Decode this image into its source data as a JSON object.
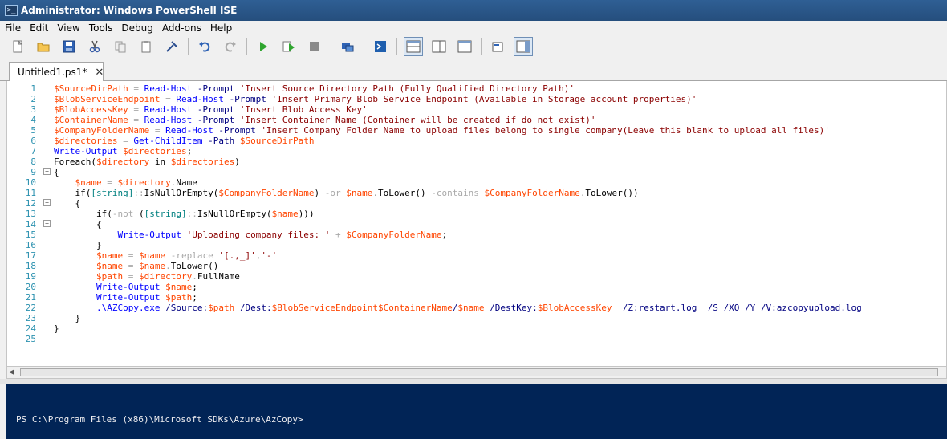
{
  "window": {
    "title": "Administrator: Windows PowerShell ISE",
    "app_icon_glyph": ">_"
  },
  "menu": [
    "File",
    "Edit",
    "View",
    "Tools",
    "Debug",
    "Add-ons",
    "Help"
  ],
  "toolbar": {
    "buttons": [
      {
        "name": "new-file-icon"
      },
      {
        "name": "open-folder-icon"
      },
      {
        "name": "save-icon"
      },
      {
        "name": "cut-icon"
      },
      {
        "name": "copy-icon"
      },
      {
        "name": "paste-icon"
      },
      {
        "name": "clear-console-icon"
      },
      {
        "name": "undo-icon"
      },
      {
        "name": "redo-icon"
      },
      {
        "name": "run-script-icon"
      },
      {
        "name": "run-selection-icon"
      },
      {
        "name": "stop-icon"
      },
      {
        "name": "remote-powershell-icon"
      },
      {
        "name": "powershell-console-icon"
      },
      {
        "name": "layout-top-icon"
      },
      {
        "name": "layout-right-icon"
      },
      {
        "name": "layout-max-icon"
      },
      {
        "name": "show-commands-icon"
      },
      {
        "name": "show-addon-icon"
      }
    ]
  },
  "tab": {
    "label": "Untitled1.ps1*",
    "close": "✕"
  },
  "colors": {
    "variable": "#ff4500",
    "cmdlet": "#0000ff",
    "string": "#8b0000",
    "operator": "#a9a9a9",
    "type": "#008080",
    "param": "#000080",
    "linenumber": "#2b91af",
    "console_bg": "#012456"
  },
  "code_lines": [
    [
      [
        "v",
        "$SourceDirPath"
      ],
      [
        "o",
        " = "
      ],
      [
        "c",
        "Read-Host"
      ],
      [
        "t",
        " "
      ],
      [
        "p",
        "-Prompt"
      ],
      [
        "t",
        " "
      ],
      [
        "s",
        "'Insert Source Directory Path (Fully Qualified Directory Path)'"
      ]
    ],
    [
      [
        "v",
        "$BlobServiceEndpoint"
      ],
      [
        "o",
        " = "
      ],
      [
        "c",
        "Read-Host"
      ],
      [
        "t",
        " "
      ],
      [
        "p",
        "-Prompt"
      ],
      [
        "t",
        " "
      ],
      [
        "s",
        "'Insert Primary Blob Service Endpoint (Available in Storage account properties)'"
      ]
    ],
    [
      [
        "v",
        "$BlobAccessKey"
      ],
      [
        "o",
        " = "
      ],
      [
        "c",
        "Read-Host"
      ],
      [
        "t",
        " "
      ],
      [
        "p",
        "-Prompt"
      ],
      [
        "t",
        " "
      ],
      [
        "s",
        "'Insert Blob Access Key'"
      ]
    ],
    [
      [
        "v",
        "$ContainerName"
      ],
      [
        "o",
        " = "
      ],
      [
        "c",
        "Read-Host"
      ],
      [
        "t",
        " "
      ],
      [
        "p",
        "-Prompt"
      ],
      [
        "t",
        " "
      ],
      [
        "s",
        "'Insert Container Name (Container will be created if do not exist)'"
      ]
    ],
    [
      [
        "v",
        "$CompanyFolderName"
      ],
      [
        "o",
        " = "
      ],
      [
        "c",
        "Read-Host"
      ],
      [
        "t",
        " "
      ],
      [
        "p",
        "-Prompt"
      ],
      [
        "t",
        " "
      ],
      [
        "s",
        "'Insert Company Folder Name to upload files belong to single company(Leave this blank to upload all files)'"
      ]
    ],
    [
      [
        "v",
        "$directories"
      ],
      [
        "o",
        " = "
      ],
      [
        "c",
        "Get-ChildItem"
      ],
      [
        "t",
        " "
      ],
      [
        "p",
        "-Path"
      ],
      [
        "t",
        " "
      ],
      [
        "v",
        "$SourceDirPath"
      ]
    ],
    [
      [
        "c",
        "Write-Output"
      ],
      [
        "t",
        " "
      ],
      [
        "v",
        "$directories"
      ],
      [
        "t",
        ";"
      ]
    ],
    [
      [
        "t",
        "Foreach("
      ],
      [
        "v",
        "$directory"
      ],
      [
        "t",
        " in "
      ],
      [
        "v",
        "$directories"
      ],
      [
        "t",
        ")"
      ]
    ],
    [
      [
        "t",
        "{"
      ]
    ],
    [
      [
        "t",
        "    "
      ],
      [
        "v",
        "$name"
      ],
      [
        "o",
        " = "
      ],
      [
        "v",
        "$directory"
      ],
      [
        "o",
        "."
      ],
      [
        "t",
        "Name"
      ]
    ],
    [
      [
        "t",
        "    if("
      ],
      [
        "y",
        "[string]"
      ],
      [
        "o",
        "::"
      ],
      [
        "t",
        "IsNullOrEmpty("
      ],
      [
        "v",
        "$CompanyFolderName"
      ],
      [
        "t",
        ") "
      ],
      [
        "o",
        "-or"
      ],
      [
        "t",
        " "
      ],
      [
        "v",
        "$name"
      ],
      [
        "o",
        "."
      ],
      [
        "t",
        "ToLower() "
      ],
      [
        "o",
        "-contains"
      ],
      [
        "t",
        " "
      ],
      [
        "v",
        "$CompanyFolderName"
      ],
      [
        "o",
        "."
      ],
      [
        "t",
        "ToLower())"
      ]
    ],
    [
      [
        "t",
        "    {"
      ]
    ],
    [
      [
        "t",
        "        if("
      ],
      [
        "o",
        "-not"
      ],
      [
        "t",
        " ("
      ],
      [
        "y",
        "[string]"
      ],
      [
        "o",
        "::"
      ],
      [
        "t",
        "IsNullOrEmpty("
      ],
      [
        "v",
        "$name"
      ],
      [
        "t",
        "))"
      ],
      [
        "t",
        ")"
      ]
    ],
    [
      [
        "t",
        "        {"
      ]
    ],
    [
      [
        "t",
        "            "
      ],
      [
        "c",
        "Write-Output"
      ],
      [
        "t",
        " "
      ],
      [
        "s",
        "'Uploading company files: '"
      ],
      [
        "o",
        " + "
      ],
      [
        "v",
        "$CompanyFolderName"
      ],
      [
        "t",
        ";"
      ]
    ],
    [
      [
        "t",
        "        }"
      ]
    ],
    [
      [
        "t",
        "        "
      ],
      [
        "v",
        "$name"
      ],
      [
        "o",
        " = "
      ],
      [
        "v",
        "$name"
      ],
      [
        "t",
        " "
      ],
      [
        "o",
        "-replace"
      ],
      [
        "t",
        " "
      ],
      [
        "s",
        "'[.,_]'"
      ],
      [
        "o",
        ","
      ],
      [
        "s",
        "'-'"
      ]
    ],
    [
      [
        "t",
        "        "
      ],
      [
        "v",
        "$name"
      ],
      [
        "o",
        " = "
      ],
      [
        "v",
        "$name"
      ],
      [
        "o",
        "."
      ],
      [
        "t",
        "ToLower()"
      ]
    ],
    [
      [
        "t",
        "        "
      ],
      [
        "v",
        "$path"
      ],
      [
        "o",
        " = "
      ],
      [
        "v",
        "$directory"
      ],
      [
        "o",
        "."
      ],
      [
        "t",
        "FullName"
      ]
    ],
    [
      [
        "t",
        "        "
      ],
      [
        "c",
        "Write-Output"
      ],
      [
        "t",
        " "
      ],
      [
        "v",
        "$name"
      ],
      [
        "t",
        ";"
      ]
    ],
    [
      [
        "t",
        "        "
      ],
      [
        "c",
        "Write-Output"
      ],
      [
        "t",
        " "
      ],
      [
        "v",
        "$path"
      ],
      [
        "t",
        ";"
      ]
    ],
    [
      [
        "t",
        "        "
      ],
      [
        "c",
        ".\\AZCopy.exe"
      ],
      [
        "t",
        " "
      ],
      [
        "p",
        "/Source:"
      ],
      [
        "v",
        "$path"
      ],
      [
        "t",
        " "
      ],
      [
        "p",
        "/Dest:"
      ],
      [
        "v",
        "$BlobServiceEndpoint$ContainerName"
      ],
      [
        "p",
        "/"
      ],
      [
        "v",
        "$name"
      ],
      [
        "t",
        " "
      ],
      [
        "p",
        "/DestKey:"
      ],
      [
        "v",
        "$BlobAccessKey"
      ],
      [
        "t",
        "  "
      ],
      [
        "p",
        "/Z:restart.log"
      ],
      [
        "t",
        "  "
      ],
      [
        "p",
        "/S"
      ],
      [
        "t",
        " "
      ],
      [
        "p",
        "/XO"
      ],
      [
        "t",
        " "
      ],
      [
        "p",
        "/Y"
      ],
      [
        "t",
        " "
      ],
      [
        "p",
        "/V:azcopyupload.log"
      ]
    ],
    [
      [
        "t",
        "    }"
      ]
    ],
    [
      [
        "t",
        "}"
      ]
    ],
    [
      [
        "t",
        ""
      ]
    ]
  ],
  "fold_markers": [
    9,
    12,
    14
  ],
  "console": {
    "prompt": "PS C:\\Program Files (x86)\\Microsoft SDKs\\Azure\\AzCopy>"
  }
}
